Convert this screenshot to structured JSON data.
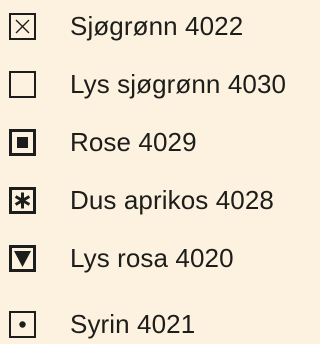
{
  "background_color": "#fdf2df",
  "text_color": "#1d1d1b",
  "legend": {
    "items": [
      {
        "label": "Sjøgrønn 4022",
        "symbol": "box-cross-icon"
      },
      {
        "label": "Lys sjøgrønn 4030",
        "symbol": "box-empty-icon"
      },
      {
        "label": "Rose 4029",
        "symbol": "box-filled-square-icon"
      },
      {
        "label": "Dus aprikos 4028",
        "symbol": "box-asterisk-icon"
      },
      {
        "label": "Lys rosa 4020",
        "symbol": "box-triangle-down-icon"
      },
      {
        "label": "Syrin 4021",
        "symbol": "box-dot-icon"
      }
    ]
  }
}
